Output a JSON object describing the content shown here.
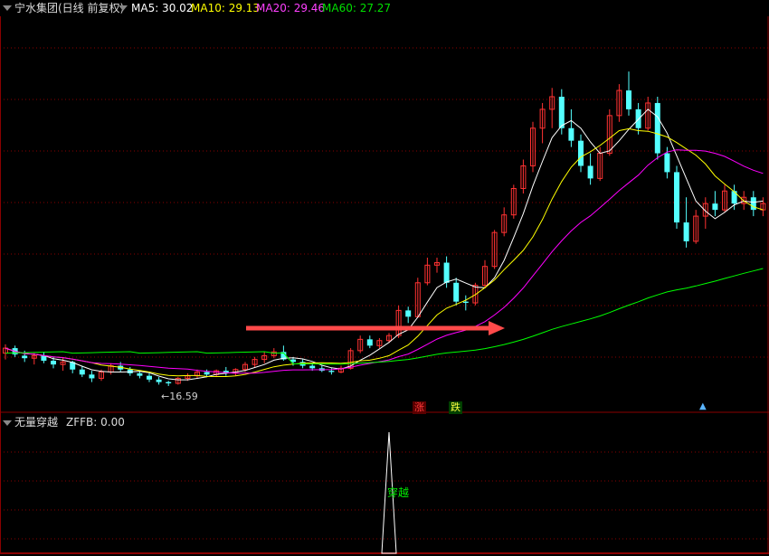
{
  "main_panel": {
    "stock_title": "宁水集团(日线 前复权)",
    "ma5": "MA5: 30.02",
    "ma10": "MA10: 29.13",
    "ma20": "MA20: 29.46",
    "ma60": "MA60: 27.27",
    "low_marker": "16.59",
    "rise_label": "涨",
    "fall_label": "跌",
    "colors": {
      "ma5": "#ffffff",
      "ma10": "#ffff00",
      "ma20": "#ff00ff",
      "ma60": "#00ff00",
      "up": "#ff3232",
      "down": "#54ffff",
      "arrow": "#ff4a4a",
      "grid": "#8a0000"
    }
  },
  "sub_panel": {
    "indicator_name": "无量穿越",
    "value_text": "ZFFB: 0.00",
    "cross_label": "穿越"
  },
  "chart_data": {
    "type": "candlestick",
    "candles_ohlc": [
      [
        19.2,
        19.9,
        18.7,
        19.6
      ],
      [
        19.6,
        19.8,
        18.9,
        19.1
      ],
      [
        19.0,
        19.4,
        18.5,
        18.8
      ],
      [
        18.8,
        19.2,
        18.3,
        19.0
      ],
      [
        19.0,
        19.3,
        18.4,
        18.6
      ],
      [
        18.6,
        18.9,
        18.0,
        18.3
      ],
      [
        18.3,
        18.8,
        17.8,
        18.5
      ],
      [
        18.5,
        18.6,
        17.6,
        17.9
      ],
      [
        17.9,
        18.2,
        17.3,
        17.5
      ],
      [
        17.5,
        17.8,
        16.9,
        17.2
      ],
      [
        17.2,
        17.9,
        17.0,
        17.7
      ],
      [
        17.7,
        18.4,
        17.5,
        18.2
      ],
      [
        18.2,
        18.5,
        17.7,
        17.9
      ],
      [
        17.9,
        18.1,
        17.4,
        17.6
      ],
      [
        17.6,
        17.8,
        17.2,
        17.4
      ],
      [
        17.4,
        17.6,
        16.9,
        17.1
      ],
      [
        17.1,
        17.3,
        16.7,
        16.9
      ],
      [
        16.9,
        17.0,
        16.59,
        16.8
      ],
      [
        16.8,
        17.3,
        16.7,
        17.2
      ],
      [
        17.2,
        17.6,
        17.0,
        17.4
      ],
      [
        17.4,
        17.9,
        17.2,
        17.7
      ],
      [
        17.7,
        17.9,
        17.3,
        17.5
      ],
      [
        17.5,
        17.9,
        17.3,
        17.8
      ],
      [
        17.8,
        18.1,
        17.4,
        17.6
      ],
      [
        17.6,
        18.0,
        17.4,
        17.9
      ],
      [
        17.9,
        18.5,
        17.7,
        18.3
      ],
      [
        18.3,
        18.9,
        18.1,
        18.7
      ],
      [
        18.7,
        19.3,
        18.4,
        19.0
      ],
      [
        19.0,
        19.6,
        18.8,
        19.3
      ],
      [
        19.3,
        19.8,
        18.6,
        18.7
      ],
      [
        18.7,
        18.9,
        18.2,
        18.5
      ],
      [
        18.5,
        18.7,
        18.0,
        18.2
      ],
      [
        18.2,
        18.4,
        17.8,
        18.0
      ],
      [
        18.0,
        18.2,
        17.7,
        17.8
      ],
      [
        17.8,
        18.0,
        17.5,
        17.7
      ],
      [
        17.7,
        18.2,
        17.6,
        18.0
      ],
      [
        18.0,
        19.6,
        17.9,
        19.4
      ],
      [
        19.4,
        20.6,
        19.2,
        20.3
      ],
      [
        20.3,
        20.6,
        19.6,
        19.8
      ],
      [
        19.8,
        20.4,
        19.6,
        20.2
      ],
      [
        20.2,
        20.8,
        20.0,
        20.6
      ],
      [
        20.6,
        23.0,
        20.4,
        22.6
      ],
      [
        22.6,
        22.9,
        21.6,
        22.1
      ],
      [
        22.1,
        25.2,
        22.0,
        24.8
      ],
      [
        24.8,
        26.8,
        24.6,
        26.2
      ],
      [
        26.2,
        26.8,
        25.6,
        26.4
      ],
      [
        26.4,
        26.9,
        24.4,
        24.8
      ],
      [
        24.8,
        25.2,
        23.0,
        23.3
      ],
      [
        23.3,
        23.8,
        22.6,
        23.2
      ],
      [
        23.2,
        24.8,
        23.0,
        24.6
      ],
      [
        24.6,
        26.6,
        24.4,
        26.1
      ],
      [
        26.1,
        29.0,
        25.9,
        28.8
      ],
      [
        28.8,
        30.8,
        28.5,
        30.2
      ],
      [
        30.2,
        32.6,
        29.9,
        32.3
      ],
      [
        32.3,
        34.6,
        31.9,
        34.1
      ],
      [
        34.1,
        37.6,
        33.6,
        37.1
      ],
      [
        37.1,
        39.1,
        35.9,
        38.6
      ],
      [
        38.6,
        40.3,
        37.1,
        39.6
      ],
      [
        39.6,
        40.2,
        36.6,
        37.1
      ],
      [
        37.1,
        38.6,
        35.6,
        36.1
      ],
      [
        36.1,
        36.6,
        33.6,
        34.1
      ],
      [
        34.1,
        35.1,
        32.6,
        33.1
      ],
      [
        33.1,
        35.6,
        32.9,
        35.1
      ],
      [
        35.1,
        38.6,
        34.9,
        38.1
      ],
      [
        38.1,
        40.6,
        37.6,
        40.1
      ],
      [
        40.1,
        41.6,
        38.1,
        38.6
      ],
      [
        38.6,
        39.1,
        36.6,
        37.1
      ],
      [
        37.1,
        39.6,
        36.9,
        39.1
      ],
      [
        39.1,
        39.6,
        34.6,
        35.1
      ],
      [
        35.1,
        35.6,
        33.1,
        33.6
      ],
      [
        33.6,
        34.1,
        29.1,
        29.6
      ],
      [
        29.6,
        31.6,
        27.6,
        28.1
      ],
      [
        28.1,
        30.6,
        27.9,
        30.1
      ],
      [
        30.1,
        31.6,
        29.1,
        31.1
      ],
      [
        31.1,
        32.1,
        30.1,
        30.6
      ],
      [
        30.6,
        32.6,
        30.4,
        32.1
      ],
      [
        32.1,
        32.6,
        30.6,
        31.1
      ],
      [
        31.1,
        32.1,
        30.6,
        31.6
      ],
      [
        31.6,
        32.1,
        30.1,
        30.6
      ],
      [
        30.6,
        31.6,
        30.1,
        31.1
      ]
    ],
    "annotations": [
      "16.59",
      "涨",
      "跌"
    ]
  }
}
